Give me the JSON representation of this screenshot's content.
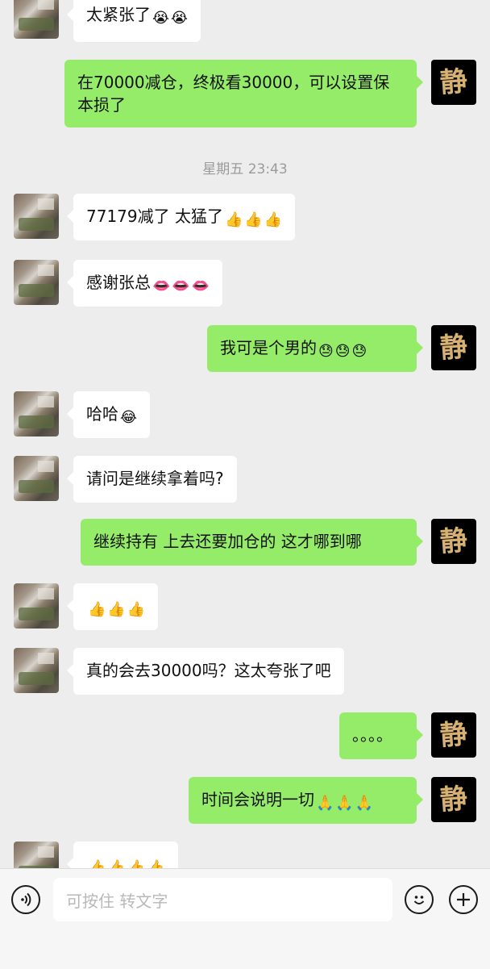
{
  "messages": [
    {
      "side": "in",
      "text": "太紧张了",
      "emojis": [
        "😭",
        "😭"
      ]
    },
    {
      "side": "out",
      "text": "在70000减仓，终极看30000，可以设置保本损了",
      "emojis": []
    },
    {
      "side": "time",
      "text": "星期五 23:43"
    },
    {
      "side": "in",
      "text": "77179减了 太猛了",
      "emojis": [
        "👍",
        "👍",
        "👍"
      ]
    },
    {
      "side": "in",
      "text": "感谢张总",
      "emojis": [
        "👄",
        "👄",
        "👄"
      ]
    },
    {
      "side": "out",
      "text": "我可是个男的",
      "emojis": [
        "😓",
        "😓",
        "😓"
      ]
    },
    {
      "side": "in",
      "text": "哈哈",
      "emojis": [
        "😂"
      ]
    },
    {
      "side": "in",
      "text": "请问是继续拿着吗?",
      "emojis": []
    },
    {
      "side": "out",
      "text": "继续持有 上去还要加仓的 这才哪到哪",
      "emojis": []
    },
    {
      "side": "in",
      "text": "",
      "emojis": [
        "👍",
        "👍",
        "👍"
      ]
    },
    {
      "side": "in",
      "text": "真的会去30000吗？这太夸张了吧",
      "emojis": []
    },
    {
      "side": "out",
      "text": "。。。。",
      "emojis": []
    },
    {
      "side": "out",
      "text": "时间会说明一切",
      "emojis": [
        "🙏",
        "🙏",
        "🙏"
      ]
    },
    {
      "side": "in",
      "text": "",
      "emojis": [
        "👍",
        "👍",
        "👍",
        "👍"
      ]
    }
  ],
  "contact_avatar_glyph": "静",
  "input": {
    "placeholder": "可按住 转文字"
  },
  "icons": {
    "voice": "voice-icon",
    "emoji": "emoji-icon",
    "plus": "plus-icon"
  },
  "colors": {
    "out_bubble": "#95ec69",
    "in_bubble": "#ffffff",
    "background": "#ededed"
  }
}
